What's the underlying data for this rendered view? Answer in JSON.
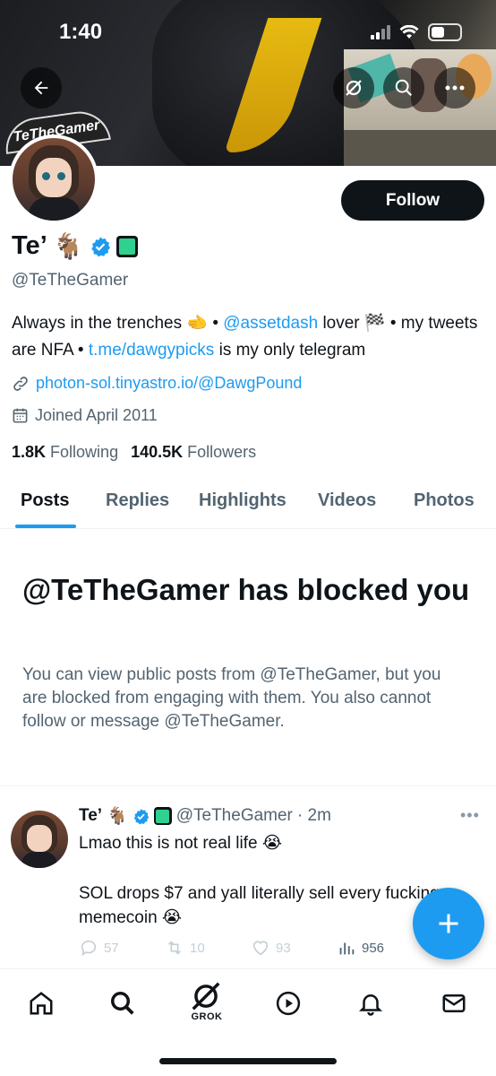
{
  "status_bar": {
    "time": "1:40"
  },
  "banner": {
    "sticker_text": "TeTheGamer"
  },
  "profile": {
    "name": "Te’",
    "name_emoji": "🐐",
    "handle": "@TeTheGamer",
    "follow_label": "Follow",
    "bio": {
      "part1": "Always in the trenches ",
      "emoji1": "🫲",
      "sep1": " • ",
      "mention": "@assetdash",
      "part2": " lover ",
      "emoji2": "🏁",
      "part3": " • my tweets are NFA • ",
      "tg_link": "t.me/dawgypicks",
      "part4": " is my only telegram"
    },
    "website": "photon-sol.tinyastro.io/@DawgPound",
    "joined": "Joined April 2011",
    "following_count": "1.8K",
    "following_label": "Following",
    "followers_count": "140.5K",
    "followers_label": "Followers"
  },
  "tabs": [
    {
      "label": "Posts",
      "active": true
    },
    {
      "label": "Replies"
    },
    {
      "label": "Highlights"
    },
    {
      "label": "Videos"
    },
    {
      "label": "Photos"
    }
  ],
  "blocked": {
    "title": "@TeTheGamer has blocked you",
    "text": "You can view public posts from @TeTheGamer, but you are blocked from engaging with them. You also cannot follow or message @TeTheGamer."
  },
  "post": {
    "name": "Te’",
    "name_emoji": "🐐",
    "handle": "@TeTheGamer",
    "time": "· 2m",
    "text1": "Lmao this is not real life 😭",
    "text2": "SOL drops $7 and yall literally sell every fucking memecoin 😭",
    "replies": "57",
    "reposts": "10",
    "likes": "93",
    "views": "956"
  },
  "nav": {
    "grok_label": "GROK"
  },
  "colors": {
    "accent": "#1d9bf0",
    "text": "#0f1419",
    "muted": "#536471"
  },
  "icons": [
    "back-arrow-icon",
    "grok-icon",
    "search-icon",
    "more-icon",
    "link-icon",
    "calendar-icon",
    "verified-icon",
    "reply-icon",
    "repost-icon",
    "like-icon",
    "views-icon",
    "compose-plus-icon",
    "home-icon",
    "explore-search-icon",
    "play-icon",
    "bell-icon",
    "mail-icon"
  ]
}
